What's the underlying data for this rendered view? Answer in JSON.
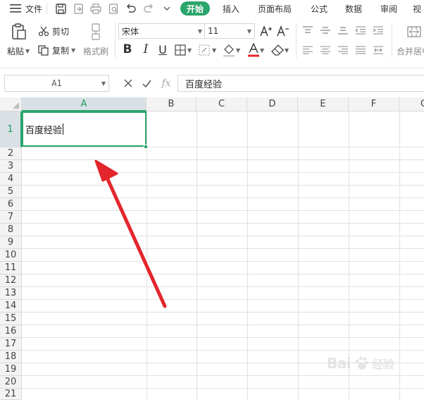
{
  "menubar": {
    "file_label": "文件",
    "tabs": [
      "开始",
      "插入",
      "页面布局",
      "公式",
      "数据",
      "审阅",
      "视"
    ]
  },
  "ribbon": {
    "paste_label": "粘贴",
    "cut_label": "剪切",
    "copy_label": "复制",
    "format_painter_label": "格式刷",
    "font_name": "宋体",
    "font_size": "11",
    "merge_label": "合并居中"
  },
  "formula_bar": {
    "cell_ref": "A1",
    "fx_label": "fx",
    "content": "百度经验"
  },
  "grid": {
    "columns": [
      "A",
      "B",
      "C",
      "D",
      "E",
      "F",
      "G"
    ],
    "rows": [
      "1",
      "2",
      "3",
      "4",
      "5",
      "6",
      "7",
      "8",
      "9",
      "10",
      "11",
      "12",
      "13",
      "14",
      "15",
      "16",
      "17",
      "18",
      "19",
      "20",
      "21"
    ],
    "active_cell_value": "百度经验"
  },
  "watermark": {
    "text": "Bai",
    "text2": "经验"
  },
  "colors": {
    "accent": "#2aa56b",
    "arrow": "#e3262c"
  }
}
